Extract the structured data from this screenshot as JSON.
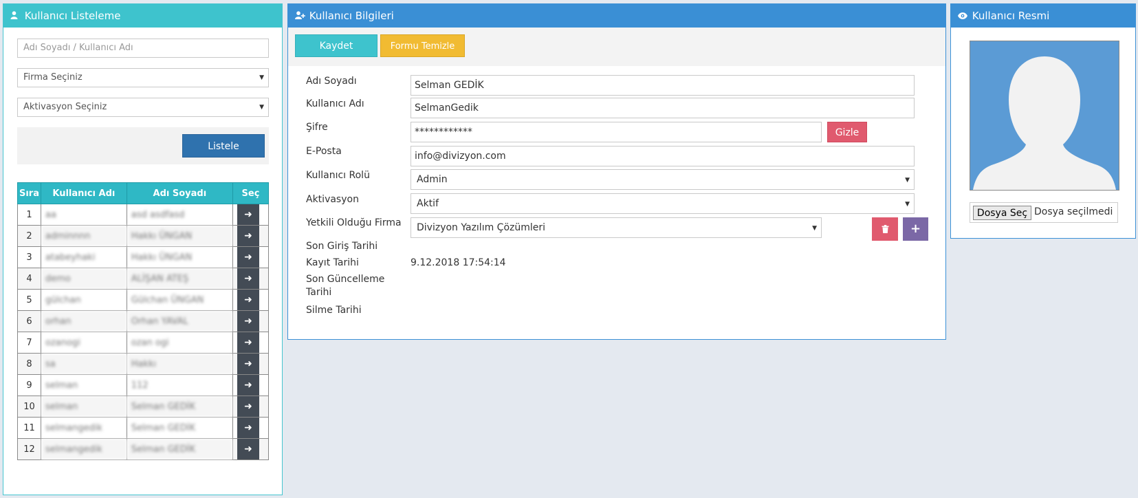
{
  "list_panel": {
    "title": "Kullanıcı Listeleme",
    "search_placeholder": "Adı Soyadı / Kullanıcı Adı",
    "firma_select": "Firma Seçiniz",
    "aktivasyon_select": "Aktivasyon Seçiniz",
    "list_button": "Listele",
    "columns": [
      "Sıra",
      "Kullanıcı Adı",
      "Adı Soyadı",
      "Seç"
    ],
    "rows": [
      {
        "no": "1",
        "username": "aa",
        "fullname": "asd asdfasd"
      },
      {
        "no": "2",
        "username": "adminnnn",
        "fullname": "Hakkı ÜNGAN"
      },
      {
        "no": "3",
        "username": "atabeyhaki",
        "fullname": "Hakkı ÜNGAN"
      },
      {
        "no": "4",
        "username": "demo",
        "fullname": "ALİŞAN ATEŞ"
      },
      {
        "no": "5",
        "username": "gülchan",
        "fullname": "Gülchan ÜNGAN"
      },
      {
        "no": "6",
        "username": "orhan",
        "fullname": "Orhan YAVAL"
      },
      {
        "no": "7",
        "username": "ozanogi",
        "fullname": "ozan ogi"
      },
      {
        "no": "8",
        "username": "sa",
        "fullname": "Hakkı"
      },
      {
        "no": "9",
        "username": "selman",
        "fullname": "112"
      },
      {
        "no": "10",
        "username": "selman",
        "fullname": "Selman GEDİK"
      },
      {
        "no": "11",
        "username": "selmangedik",
        "fullname": "Selman GEDİK"
      },
      {
        "no": "12",
        "username": "selmangedik",
        "fullname": "Selman GEDİK"
      }
    ]
  },
  "info_panel": {
    "title": "Kullanıcı Bilgileri",
    "save_button": "Kaydet",
    "clear_button": "Formu Temizle",
    "labels": {
      "fullname": "Adı Soyadı",
      "username": "Kullanıcı Adı",
      "password": "Şifre",
      "email": "E-Posta",
      "role": "Kullanıcı Rolü",
      "activation": "Aktivasyon",
      "company": "Yetkili Olduğu Firma",
      "last_login": "Son Giriş Tarihi",
      "created": "Kayıt Tarihi",
      "updated": "Son Güncelleme Tarihi",
      "deleted": "Silme Tarihi"
    },
    "values": {
      "fullname": "Selman GEDİK",
      "username": "SelmanGedik",
      "password": "************",
      "email": "info@divizyon.com",
      "role": "Admin",
      "activation": "Aktif",
      "company": "Divizyon Yazılım Çözümleri",
      "created": "9.12.2018 17:54:14"
    },
    "hide_button": "Gizle"
  },
  "photo_panel": {
    "title": "Kullanıcı Resmi",
    "file_button": "Dosya Seç",
    "file_status": "Dosya seçilmedi"
  },
  "colors": {
    "teal": "#3ec3cd",
    "blue": "#3a8fd5",
    "dark_blue_button": "#2f72ae",
    "yellow": "#f1bb32",
    "red": "#e05a6e",
    "purple": "#7b68a6"
  },
  "icons": [
    "user-icon",
    "user-plus-icon",
    "eye-icon",
    "arrow-right-icon",
    "trash-icon",
    "plus-icon",
    "avatar-placeholder"
  ]
}
